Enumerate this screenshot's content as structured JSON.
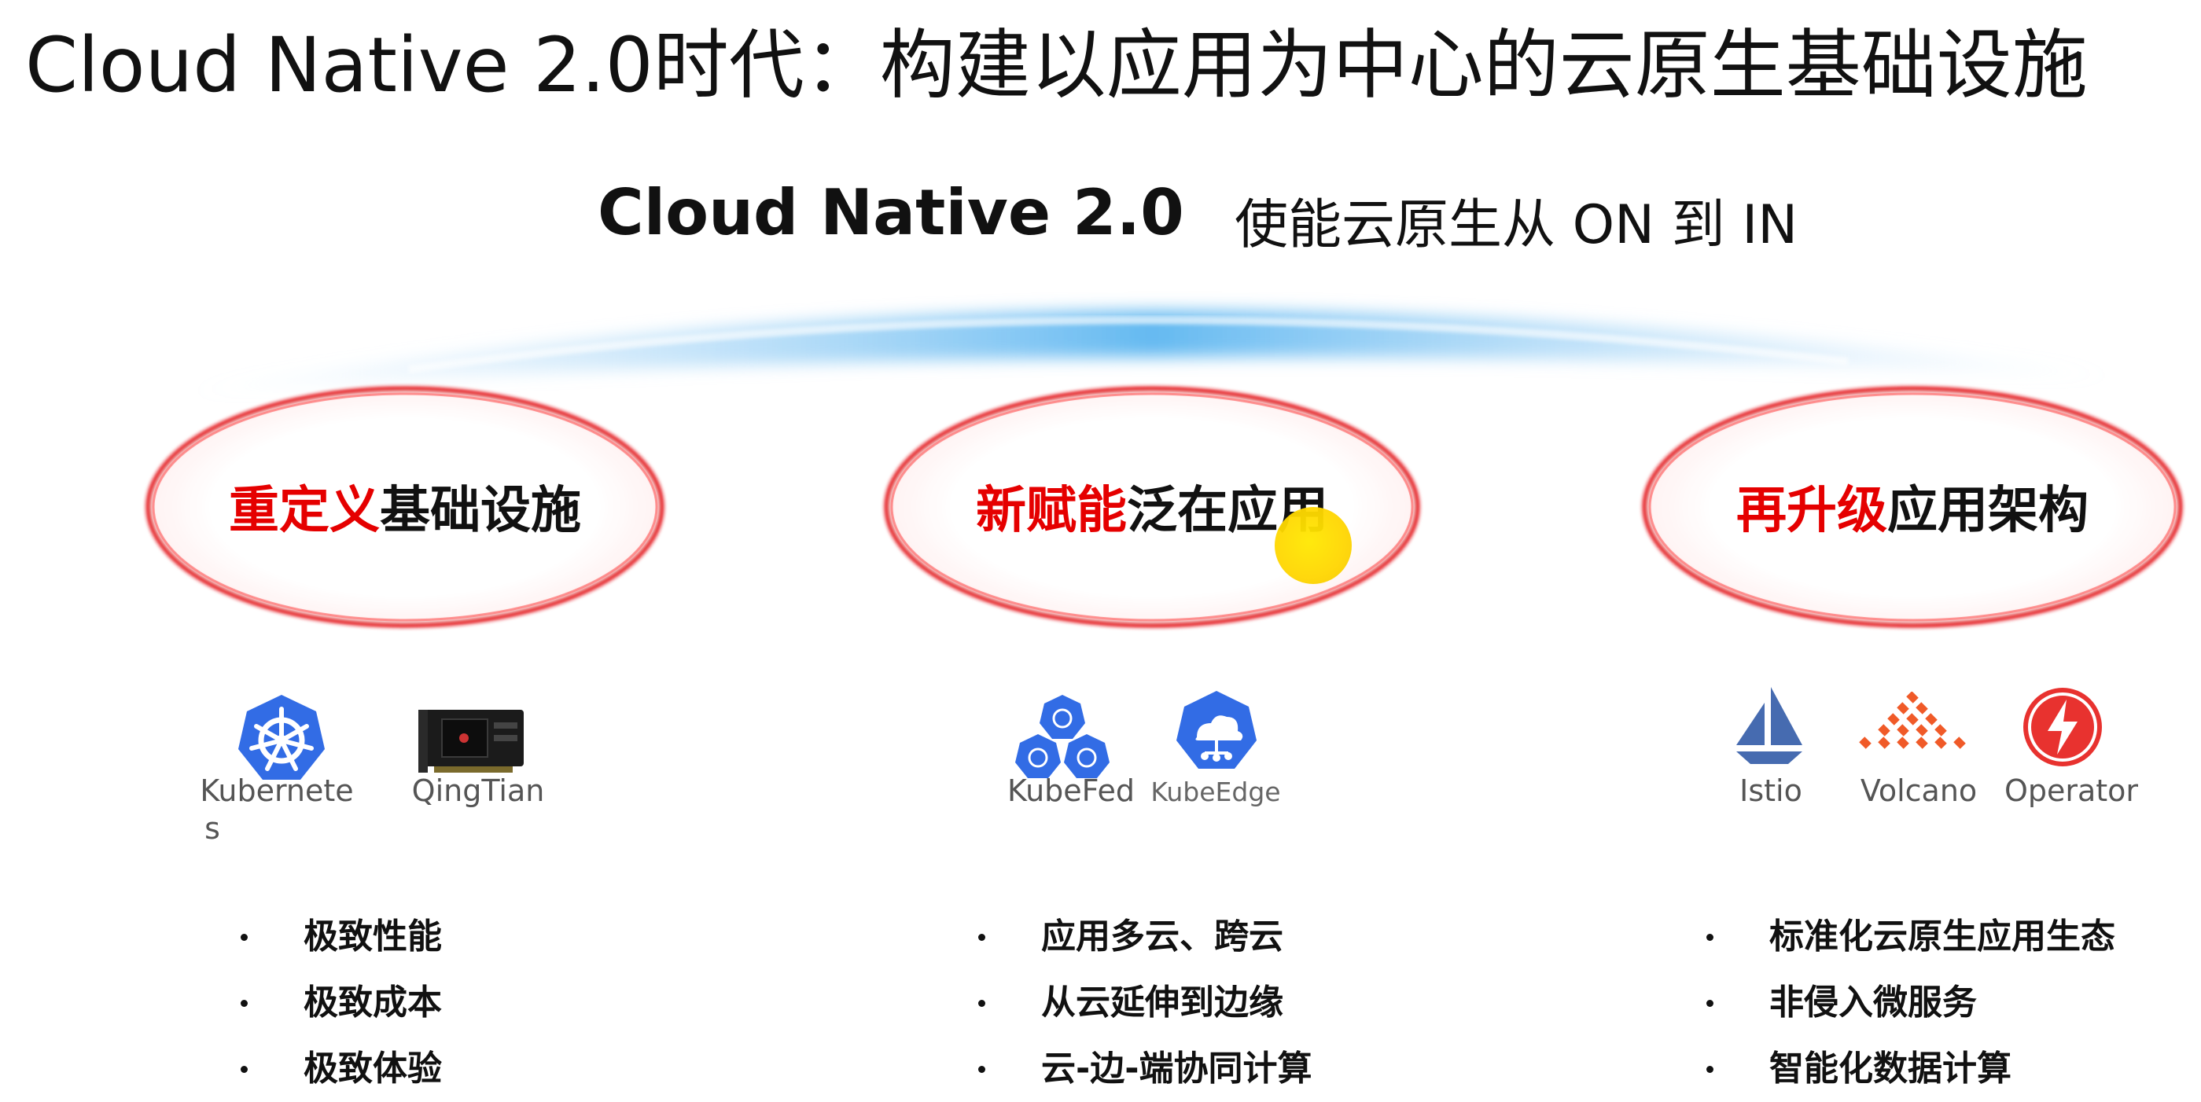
{
  "title": "Cloud Native 2.0时代：构建以应用为中心的云原生基础设施",
  "subtitle": {
    "main": "Cloud Native 2.0",
    "tagline": "使能云原生从 ON 到 IN"
  },
  "pillars": [
    {
      "title_red": "重定义",
      "title_black": "基础设施",
      "icons": [
        {
          "name": "kubernetes-icon",
          "label_line1": "Kubernete",
          "label_line2": "s"
        },
        {
          "name": "qingtian-card-icon",
          "label": "QingTian"
        }
      ],
      "bullets": [
        "极致性能",
        "极致成本",
        "极致体验"
      ]
    },
    {
      "title_red": "新赋能",
      "title_black": "泛在应用",
      "icons": [
        {
          "name": "kubefed-icon",
          "label": "KubeFed"
        },
        {
          "name": "kubeedge-icon",
          "label": "KubeEdge"
        }
      ],
      "bullets": [
        "应用多云、跨云",
        "从云延伸到边缘",
        "云-边-端协同计算"
      ]
    },
    {
      "title_red": "再升级",
      "title_black": "应用架构",
      "icons": [
        {
          "name": "istio-icon",
          "label": "Istio"
        },
        {
          "name": "volcano-icon",
          "label": "Volcano"
        },
        {
          "name": "operator-icon",
          "label": "Operator"
        }
      ],
      "bullets": [
        "标准化云原生应用生态",
        "非侵入微服务",
        "智能化数据计算"
      ]
    }
  ],
  "colors": {
    "accent_red": "#e50000",
    "arc_blue": "#4aa8ea",
    "k8s_blue": "#326ce5",
    "istio_navy": "#466bb0",
    "volcano_orange": "#f05a28",
    "operator_red": "#e8322f",
    "pointer_yellow": "#ffd600"
  }
}
